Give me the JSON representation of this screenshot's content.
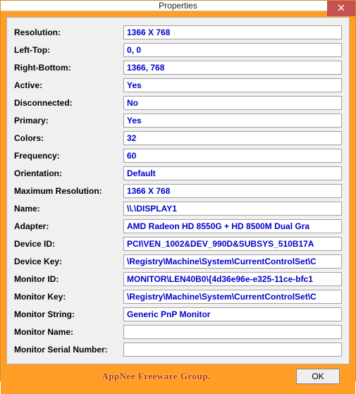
{
  "window": {
    "title": "Properties"
  },
  "fields": [
    {
      "label": "Resolution:",
      "value": "1366 X 768"
    },
    {
      "label": "Left-Top:",
      "value": "0, 0"
    },
    {
      "label": "Right-Bottom:",
      "value": "1366, 768"
    },
    {
      "label": "Active:",
      "value": "Yes"
    },
    {
      "label": "Disconnected:",
      "value": "No"
    },
    {
      "label": "Primary:",
      "value": "Yes"
    },
    {
      "label": "Colors:",
      "value": "32"
    },
    {
      "label": "Frequency:",
      "value": "60"
    },
    {
      "label": "Orientation:",
      "value": "Default"
    },
    {
      "label": "Maximum Resolution:",
      "value": "1366 X 768"
    },
    {
      "label": "Name:",
      "value": "\\\\.\\DISPLAY1"
    },
    {
      "label": "Adapter:",
      "value": "AMD Radeon HD 8550G + HD 8500M Dual Gra"
    },
    {
      "label": "Device ID:",
      "value": "PCI\\VEN_1002&DEV_990D&SUBSYS_510B17A"
    },
    {
      "label": "Device Key:",
      "value": "\\Registry\\Machine\\System\\CurrentControlSet\\C"
    },
    {
      "label": "Monitor ID:",
      "value": "MONITOR\\LEN40B0\\{4d36e96e-e325-11ce-bfc1"
    },
    {
      "label": "Monitor Key:",
      "value": "\\Registry\\Machine\\System\\CurrentControlSet\\C"
    },
    {
      "label": "Monitor String:",
      "value": "Generic PnP Monitor"
    },
    {
      "label": "Monitor Name:",
      "value": ""
    },
    {
      "label": "Monitor Serial Number:",
      "value": ""
    }
  ],
  "footer": {
    "text": "AppNee Freeware Group.",
    "ok": "OK"
  }
}
